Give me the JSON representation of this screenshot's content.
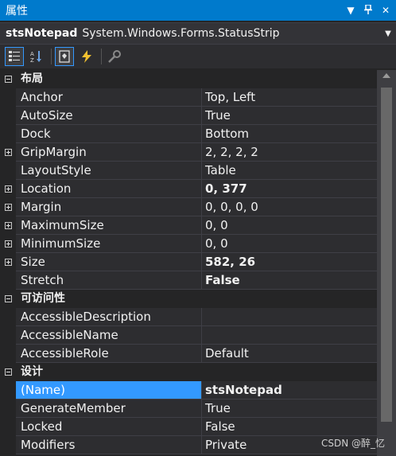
{
  "window": {
    "title": "属性",
    "pin_icon": "pin-icon",
    "dropdown_icon": "dropdown-icon",
    "close_icon": "close-icon"
  },
  "object": {
    "name": "stsNotepad",
    "type": "System.Windows.Forms.StatusStrip"
  },
  "toolbar": {
    "buttons": [
      "categorized-icon",
      "alphabetical-icon",
      "properties-icon",
      "events-icon",
      "property-pages-icon"
    ]
  },
  "categories": [
    {
      "label": "布局",
      "rows": [
        {
          "name": "Anchor",
          "value": "Top, Left"
        },
        {
          "name": "AutoSize",
          "value": "True"
        },
        {
          "name": "Dock",
          "value": "Bottom"
        },
        {
          "name": "GripMargin",
          "value": "2, 2, 2, 2"
        },
        {
          "name": "LayoutStyle",
          "value": "Table"
        },
        {
          "name": "Location",
          "value": "0, 377"
        },
        {
          "name": "Margin",
          "value": "0, 0, 0, 0"
        },
        {
          "name": "MaximumSize",
          "value": "0, 0"
        },
        {
          "name": "MinimumSize",
          "value": "0, 0"
        },
        {
          "name": "Size",
          "value": "582, 26"
        },
        {
          "name": "Stretch",
          "value": "False"
        }
      ]
    },
    {
      "label": "可访问性",
      "rows": [
        {
          "name": "AccessibleDescription",
          "value": ""
        },
        {
          "name": "AccessibleName",
          "value": ""
        },
        {
          "name": "AccessibleRole",
          "value": "Default"
        }
      ]
    },
    {
      "label": "设计",
      "rows": [
        {
          "name": "(Name)",
          "value": "stsNotepad"
        },
        {
          "name": "GenerateMember",
          "value": "True"
        },
        {
          "name": "Locked",
          "value": "False"
        },
        {
          "name": "Modifiers",
          "value": "Private"
        }
      ]
    }
  ],
  "watermark": "CSDN @醉_忆"
}
